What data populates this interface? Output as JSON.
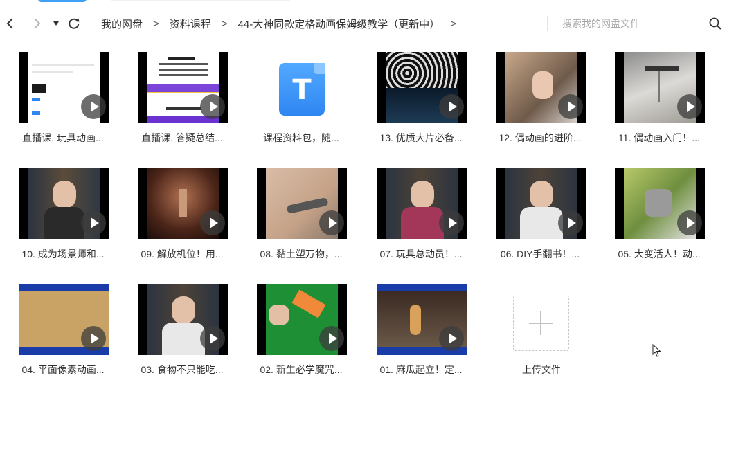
{
  "nav": {
    "back_icon": "chevron-left-icon",
    "forward_icon": "chevron-right-icon",
    "history_icon": "caret-down-icon",
    "refresh_icon": "refresh-icon"
  },
  "breadcrumb": {
    "items": [
      "我的网盘",
      "资料课程",
      "44-大神同款定格动画保姆级教学（更新中）"
    ],
    "separator": ">"
  },
  "search": {
    "placeholder": "搜索我的网盘文件",
    "value": "",
    "icon": "search-icon"
  },
  "files": [
    {
      "label": "直播课. 玩具动画...",
      "type": "video"
    },
    {
      "label": "直播课. 答疑总结...",
      "type": "video"
    },
    {
      "label": "课程资料包，随...",
      "type": "document",
      "icon_letter": "T"
    },
    {
      "label": "13. 优质大片必备...",
      "type": "video"
    },
    {
      "label": "12. 偶动画的进阶...",
      "type": "video"
    },
    {
      "label": "11. 偶动画入门！...",
      "type": "video"
    },
    {
      "label": "10. 成为场景师和...",
      "type": "video"
    },
    {
      "label": "09. 解放机位！用...",
      "type": "video"
    },
    {
      "label": "08. 黏土塑万物，...",
      "type": "video"
    },
    {
      "label": "07. 玩具总动员！...",
      "type": "video"
    },
    {
      "label": "06. DIY手翻书！...",
      "type": "video"
    },
    {
      "label": "05. 大变活人！动...",
      "type": "video"
    },
    {
      "label": "04. 平面像素动画...",
      "type": "video"
    },
    {
      "label": "03. 食物不只能吃...",
      "type": "video"
    },
    {
      "label": "02. 新生必学魔咒...",
      "type": "video"
    },
    {
      "label": "01. 麻瓜起立！定...",
      "type": "video"
    }
  ],
  "upload": {
    "label": "上传文件",
    "icon": "plus-icon"
  },
  "colors": {
    "accent": "#3fa0f5",
    "doc_icon": "#3d93f5"
  }
}
